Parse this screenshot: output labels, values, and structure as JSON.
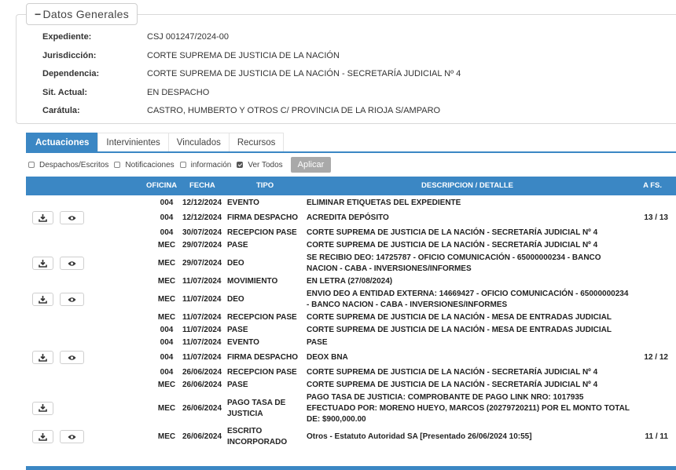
{
  "general": {
    "legend": "Datos Generales",
    "fields": [
      {
        "label": "Expediente:",
        "value": "CSJ 001247/2024-00"
      },
      {
        "label": "Jurisdicción:",
        "value": "CORTE SUPREMA DE JUSTICIA DE LA NACIÓN"
      },
      {
        "label": "Dependencia:",
        "value": "CORTE SUPREMA DE JUSTICIA DE LA NACIÓN - SECRETARÍA JUDICIAL Nº 4"
      },
      {
        "label": "Sit. Actual:",
        "value": "EN DESPACHO"
      },
      {
        "label": "Carátula:",
        "value": "CASTRO, HUMBERTO Y OTROS C/ PROVINCIA DE LA RIOJA S/AMPARO"
      }
    ]
  },
  "tabs": [
    "Actuaciones",
    "Intervinientes",
    "Vinculados",
    "Recursos"
  ],
  "filters": {
    "items": [
      {
        "label": "Despachos/Escritos",
        "checked": false
      },
      {
        "label": "Notificaciones",
        "checked": false
      },
      {
        "label": "información",
        "checked": false
      },
      {
        "label": "Ver Todos",
        "checked": true
      }
    ],
    "apply": "Aplicar"
  },
  "table": {
    "headers": {
      "oficina": "OFICINA",
      "fecha": "FECHA",
      "tipo": "TIPO",
      "descripcion": "DESCRIPCION / DETALLE",
      "afs": "A FS."
    },
    "rows": [
      {
        "download": false,
        "view": false,
        "oficina": "004",
        "fecha": "12/12/2024",
        "tipo": "EVENTO",
        "descripcion": "ELIMINAR ETIQUETAS DEL EXPEDIENTE",
        "afs": ""
      },
      {
        "download": true,
        "view": true,
        "oficina": "004",
        "fecha": "12/12/2024",
        "tipo": "FIRMA DESPACHO",
        "descripcion": "ACREDITA DEPÓSITO",
        "afs": "13 / 13"
      },
      {
        "download": false,
        "view": false,
        "oficina": "004",
        "fecha": "30/07/2024",
        "tipo": "RECEPCION PASE",
        "descripcion": "CORTE SUPREMA DE JUSTICIA DE LA NACIÓN - SECRETARÍA JUDICIAL Nº 4",
        "afs": ""
      },
      {
        "download": false,
        "view": false,
        "oficina": "MEC",
        "fecha": "29/07/2024",
        "tipo": "PASE",
        "descripcion": "CORTE SUPREMA DE JUSTICIA DE LA NACIÓN - SECRETARÍA JUDICIAL Nº 4",
        "afs": ""
      },
      {
        "download": true,
        "view": true,
        "oficina": "MEC",
        "fecha": "29/07/2024",
        "tipo": "DEO",
        "descripcion": "SE RECIBIO DEO: 14725787 - OFICIO COMUNICACIÓN - 65000000234 - BANCO NACION - CABA - INVERSIONES/INFORMES",
        "afs": ""
      },
      {
        "download": false,
        "view": false,
        "oficina": "MEC",
        "fecha": "11/07/2024",
        "tipo": "MOVIMIENTO",
        "descripcion": "EN LETRA (27/08/2024)",
        "afs": ""
      },
      {
        "download": true,
        "view": true,
        "oficina": "MEC",
        "fecha": "11/07/2024",
        "tipo": "DEO",
        "descripcion": "ENVIO DEO A ENTIDAD EXTERNA: 14669427 - OFICIO COMUNICACIÓN - 65000000234 - BANCO NACION - CABA - INVERSIONES/INFORMES",
        "afs": ""
      },
      {
        "download": false,
        "view": false,
        "oficina": "MEC",
        "fecha": "11/07/2024",
        "tipo": "RECEPCION PASE",
        "descripcion": "CORTE SUPREMA DE JUSTICIA DE LA NACIÓN - MESA DE ENTRADAS JUDICIAL",
        "afs": ""
      },
      {
        "download": false,
        "view": false,
        "oficina": "004",
        "fecha": "11/07/2024",
        "tipo": "PASE",
        "descripcion": "CORTE SUPREMA DE JUSTICIA DE LA NACIÓN - MESA DE ENTRADAS JUDICIAL",
        "afs": ""
      },
      {
        "download": false,
        "view": false,
        "oficina": "004",
        "fecha": "11/07/2024",
        "tipo": "EVENTO",
        "descripcion": "PASE",
        "afs": ""
      },
      {
        "download": true,
        "view": true,
        "oficina": "004",
        "fecha": "11/07/2024",
        "tipo": "FIRMA DESPACHO",
        "descripcion": "DEOX BNA",
        "afs": "12 / 12"
      },
      {
        "download": false,
        "view": false,
        "oficina": "004",
        "fecha": "26/06/2024",
        "tipo": "RECEPCION PASE",
        "descripcion": "CORTE SUPREMA DE JUSTICIA DE LA NACIÓN - SECRETARÍA JUDICIAL Nº 4",
        "afs": ""
      },
      {
        "download": false,
        "view": false,
        "oficina": "MEC",
        "fecha": "26/06/2024",
        "tipo": "PASE",
        "descripcion": "CORTE SUPREMA DE JUSTICIA DE LA NACIÓN - SECRETARÍA JUDICIAL Nº 4",
        "afs": ""
      },
      {
        "download": true,
        "view": false,
        "oficina": "MEC",
        "fecha": "26/06/2024",
        "tipo": "PAGO TASA DE JUSTICIA",
        "descripcion": "PAGO TASA DE JUSTICIA: COMPROBANTE DE PAGO LINK NRO: 1017935 EFECTUADO POR: MORENO HUEYO, MARCOS (20279720211) POR EL MONTO TOTAL DE: $900,000.00",
        "afs": ""
      },
      {
        "download": true,
        "view": true,
        "oficina": "MEC",
        "fecha": "26/06/2024",
        "tipo": "ESCRITO INCORPORADO",
        "descripcion": "Otros - Estatuto Autoridad SA [Presentado 26/06/2024 10:55]",
        "afs": "11 / 11"
      }
    ]
  },
  "colors": {
    "accent": "#3b87c4",
    "apply_button": "#a9a9a9"
  },
  "icons": {
    "download": "download-icon",
    "view": "eye-icon"
  }
}
